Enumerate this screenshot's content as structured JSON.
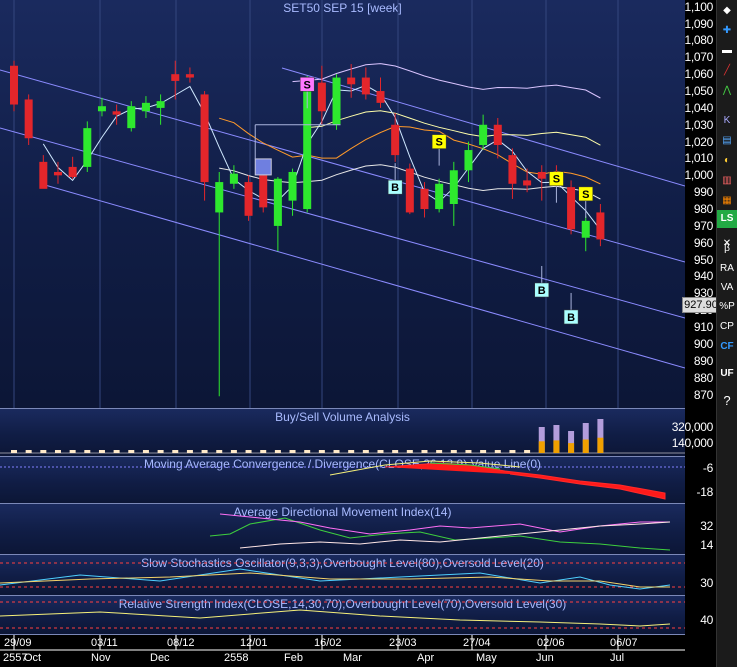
{
  "chart": {
    "title": "SET50 SEP 15  [week]",
    "last_price": "927.90",
    "yticks": [
      "1,100",
      "1,090",
      "1,080",
      "1,070",
      "1,060",
      "1,050",
      "1,040",
      "1,030",
      "1,020",
      "1,010",
      "1,000",
      "990",
      "980",
      "970",
      "960",
      "950",
      "940",
      "930",
      "920",
      "910",
      "900",
      "890",
      "880",
      "870"
    ],
    "xlabels_top": [
      "29/09",
      "03/11",
      "08/12",
      "12/01",
      "16/02",
      "23/03",
      "27/04",
      "02/06",
      "06/07"
    ],
    "xlabels_bottom": [
      "2557",
      "Oct",
      "Nov",
      "Dec",
      "2558",
      "Feb",
      "Mar",
      "Apr",
      "May",
      "Jun",
      "Jul"
    ],
    "signals": [
      {
        "type": "S",
        "week": 20,
        "price": 1054
      },
      {
        "type": "B",
        "week": 26,
        "price": 993
      },
      {
        "type": "S",
        "week": 29,
        "price": 1020
      },
      {
        "type": "S",
        "week": 37,
        "price": 998
      },
      {
        "type": "S",
        "week": 39,
        "price": 989
      },
      {
        "type": "B",
        "week": 36,
        "price": 932
      },
      {
        "type": "B",
        "week": 38,
        "price": 916
      }
    ],
    "box_marker": {
      "week": 17,
      "price": 1005
    }
  },
  "panels": {
    "volume": {
      "title": "Buy/Sell Volume Analysis",
      "yticks": [
        "320,000",
        "140,000"
      ]
    },
    "macd": {
      "title": "Moving Average Convergence / Divergence(CLOSE,26,12,9),Value Line(0)",
      "yticks": [
        "-6",
        "-18"
      ]
    },
    "adx": {
      "title": "Average Directional Movement Index(14)",
      "yticks": [
        "32",
        "14"
      ]
    },
    "stoch": {
      "title": "Slow Stochastics Oscillator(9,3,3),Overbought Level(80),Oversold Level(20)",
      "yticks": [
        "30"
      ]
    },
    "rsi": {
      "title": "Relative Strength Index(CLOSE,14,30,70),Overbought Level(70),Oversold Level(30)",
      "yticks": [
        "40"
      ]
    }
  },
  "toolbar": [
    "LS",
    "β",
    "RA",
    "VA",
    "%P",
    "CP",
    "CF",
    "UF"
  ],
  "chart_data": {
    "type": "candlestick",
    "title": "SET50 SEP 15 [week]",
    "ylim": [
      862,
      1104
    ],
    "candles": [
      {
        "o": 1065,
        "h": 1068,
        "l": 1038,
        "c": 1042
      },
      {
        "o": 1045,
        "h": 1048,
        "l": 1018,
        "c": 1022
      },
      {
        "o": 1008,
        "h": 1012,
        "l": 997,
        "c": 992
      },
      {
        "o": 1002,
        "h": 1008,
        "l": 995,
        "c": 1000
      },
      {
        "o": 1005,
        "h": 1011,
        "l": 998,
        "c": 999
      },
      {
        "o": 1005,
        "h": 1032,
        "l": 1002,
        "c": 1028
      },
      {
        "o": 1038,
        "h": 1046,
        "l": 1035,
        "c": 1041
      },
      {
        "o": 1038,
        "h": 1042,
        "l": 1030,
        "c": 1036
      },
      {
        "o": 1028,
        "h": 1044,
        "l": 1026,
        "c": 1041
      },
      {
        "o": 1038,
        "h": 1047,
        "l": 1034,
        "c": 1043
      },
      {
        "o": 1040,
        "h": 1048,
        "l": 1030,
        "c": 1044
      },
      {
        "o": 1060,
        "h": 1068,
        "l": 1045,
        "c": 1056
      },
      {
        "o": 1060,
        "h": 1064,
        "l": 1055,
        "c": 1058
      },
      {
        "o": 1048,
        "h": 1050,
        "l": 985,
        "c": 996
      },
      {
        "o": 978,
        "h": 1002,
        "l": 869,
        "c": 996
      },
      {
        "o": 995,
        "h": 1006,
        "l": 992,
        "c": 1001
      },
      {
        "o": 996,
        "h": 1000,
        "l": 973,
        "c": 976
      },
      {
        "o": 1000,
        "h": 1004,
        "l": 978,
        "c": 981
      },
      {
        "o": 970,
        "h": 999,
        "l": 955,
        "c": 998
      },
      {
        "o": 985,
        "h": 1004,
        "l": 976,
        "c": 1002
      },
      {
        "o": 980,
        "h": 1059,
        "l": 978,
        "c": 1056
      },
      {
        "o": 1055,
        "h": 1065,
        "l": 1030,
        "c": 1038
      },
      {
        "o": 1030,
        "h": 1060,
        "l": 1027,
        "c": 1058
      },
      {
        "o": 1058,
        "h": 1066,
        "l": 1046,
        "c": 1054
      },
      {
        "o": 1058,
        "h": 1064,
        "l": 1045,
        "c": 1048
      },
      {
        "o": 1050,
        "h": 1058,
        "l": 1040,
        "c": 1043
      },
      {
        "o": 1030,
        "h": 1037,
        "l": 1008,
        "c": 1012
      },
      {
        "o": 1004,
        "h": 1007,
        "l": 977,
        "c": 978
      },
      {
        "o": 992,
        "h": 996,
        "l": 975,
        "c": 980
      },
      {
        "o": 980,
        "h": 998,
        "l": 978,
        "c": 995
      },
      {
        "o": 983,
        "h": 1008,
        "l": 970,
        "c": 1003
      },
      {
        "o": 1003,
        "h": 1020,
        "l": 996,
        "c": 1015
      },
      {
        "o": 1018,
        "h": 1036,
        "l": 1015,
        "c": 1030
      },
      {
        "o": 1030,
        "h": 1034,
        "l": 1010,
        "c": 1018
      },
      {
        "o": 1012,
        "h": 1016,
        "l": 986,
        "c": 995
      },
      {
        "o": 997,
        "h": 1004,
        "l": 990,
        "c": 994
      },
      {
        "o": 1002,
        "h": 1006,
        "l": 985,
        "c": 998
      },
      {
        "o": 1000,
        "h": 1006,
        "l": 993,
        "c": 996
      },
      {
        "o": 993,
        "h": 997,
        "l": 965,
        "c": 968
      },
      {
        "o": 963,
        "h": 976,
        "l": 955,
        "c": 973
      },
      {
        "o": 978,
        "h": 983,
        "l": 958,
        "c": 962
      }
    ]
  }
}
